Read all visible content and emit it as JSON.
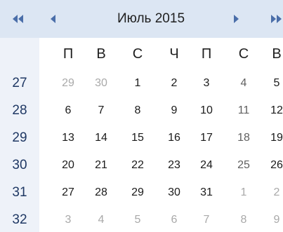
{
  "header": {
    "title": "Июль 2015",
    "prev_year_icon": "double-left-arrow",
    "prev_month_icon": "left-arrow",
    "next_month_icon": "right-arrow",
    "next_year_icon": "double-right-arrow"
  },
  "weekdays": [
    "П",
    "В",
    "С",
    "Ч",
    "П",
    "С",
    "В"
  ],
  "weeks": [
    {
      "number": "27",
      "days": [
        {
          "label": "29",
          "muted": true
        },
        {
          "label": "30",
          "muted": true
        },
        {
          "label": "1",
          "muted": false
        },
        {
          "label": "2",
          "muted": false
        },
        {
          "label": "3",
          "muted": false
        },
        {
          "label": "4",
          "muted": false
        },
        {
          "label": "5",
          "muted": false
        }
      ]
    },
    {
      "number": "28",
      "days": [
        {
          "label": "6",
          "muted": false
        },
        {
          "label": "7",
          "muted": false
        },
        {
          "label": "8",
          "muted": false
        },
        {
          "label": "9",
          "muted": false
        },
        {
          "label": "10",
          "muted": false
        },
        {
          "label": "11",
          "muted": false
        },
        {
          "label": "12",
          "muted": false
        }
      ]
    },
    {
      "number": "29",
      "days": [
        {
          "label": "13",
          "muted": false
        },
        {
          "label": "14",
          "muted": false
        },
        {
          "label": "15",
          "muted": false
        },
        {
          "label": "16",
          "muted": false
        },
        {
          "label": "17",
          "muted": false
        },
        {
          "label": "18",
          "muted": false
        },
        {
          "label": "19",
          "muted": false
        }
      ]
    },
    {
      "number": "30",
      "days": [
        {
          "label": "20",
          "muted": false
        },
        {
          "label": "21",
          "muted": false
        },
        {
          "label": "22",
          "muted": false
        },
        {
          "label": "23",
          "muted": false
        },
        {
          "label": "24",
          "muted": false
        },
        {
          "label": "25",
          "muted": false
        },
        {
          "label": "26",
          "muted": false
        }
      ]
    },
    {
      "number": "31",
      "days": [
        {
          "label": "27",
          "muted": false
        },
        {
          "label": "28",
          "muted": false
        },
        {
          "label": "29",
          "muted": false
        },
        {
          "label": "30",
          "muted": false
        },
        {
          "label": "31",
          "muted": false
        },
        {
          "label": "1",
          "muted": true
        },
        {
          "label": "2",
          "muted": true
        }
      ]
    },
    {
      "number": "32",
      "days": [
        {
          "label": "3",
          "muted": true
        },
        {
          "label": "4",
          "muted": true
        },
        {
          "label": "5",
          "muted": true
        },
        {
          "label": "6",
          "muted": true
        },
        {
          "label": "7",
          "muted": true
        },
        {
          "label": "8",
          "muted": true
        },
        {
          "label": "9",
          "muted": true
        }
      ]
    }
  ],
  "colors": {
    "header_bg": "#dce6f3",
    "week_column_bg": "#eef2f9",
    "week_number_text": "#1f3864",
    "arrow": "#4a6ea9",
    "muted_day": "#a9a9a9"
  }
}
